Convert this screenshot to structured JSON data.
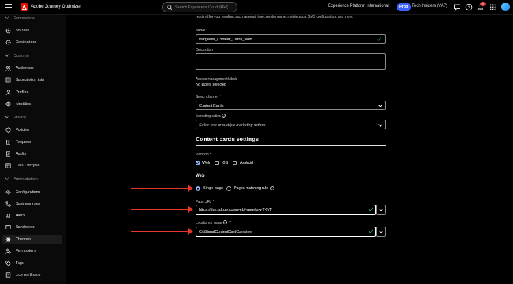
{
  "topbar": {
    "app_title": "Adobe Journey Optimizer",
    "search_placeholder": "Search Experience Cloud (⌘+/)",
    "org": "Experience Platform International",
    "env_badge": "Prod",
    "sandbox": "Tech Insiders (VA7)",
    "notification_count": "9+"
  },
  "sidebar": {
    "sections": [
      {
        "label": "Connections",
        "items": [
          "Sources",
          "Destinations"
        ]
      },
      {
        "label": "Customer",
        "items": [
          "Audiences",
          "Subscription lists",
          "Profiles",
          "Identities"
        ]
      },
      {
        "label": "Privacy",
        "items": [
          "Policies",
          "Requests",
          "Audits",
          "Data Lifecycle"
        ]
      },
      {
        "label": "Administration",
        "items": [
          "Configurations",
          "Business rules",
          "Alerts",
          "Sandboxes",
          "Channels",
          "Permissions",
          "Tags",
          "License Usage"
        ]
      }
    ],
    "active_item": "Channels"
  },
  "form": {
    "intro_text": "required for your sending, such as email type, sender name, mobile apps, SMS configuration, and more.",
    "name_label": "Name",
    "name_value": "vangeluw_Content_Cards_Web",
    "description_label": "Description",
    "description_value": "",
    "access_label": "Access management labels",
    "access_value": "No labels selected",
    "channel_label": "Select channel",
    "channel_value": "Content Cards",
    "marketing_label": "Marketing action",
    "marketing_placeholder": "Select one or multiple marketing actions",
    "required_mark": "*"
  },
  "settings": {
    "heading": "Content cards settings",
    "platform_label": "Platform",
    "platforms": [
      {
        "label": "Web",
        "checked": true
      },
      {
        "label": "iOS",
        "checked": false
      },
      {
        "label": "Android",
        "checked": false
      }
    ],
    "web_heading": "Web",
    "page_options": [
      {
        "label": "Single page",
        "selected": true
      },
      {
        "label": "Pages matching rule",
        "selected": false
      }
    ],
    "page_url_label": "Page URL",
    "page_url_value": "https://dsn.adobe.com/web/vangeluw-TKYT",
    "location_label": "Location on page",
    "location_value": "CitiSignalContentCardContainer"
  },
  "colors": {
    "accent": "#3b63fb",
    "annotation_arrow": "#e8372a",
    "valid_check": "#2d9d78"
  }
}
